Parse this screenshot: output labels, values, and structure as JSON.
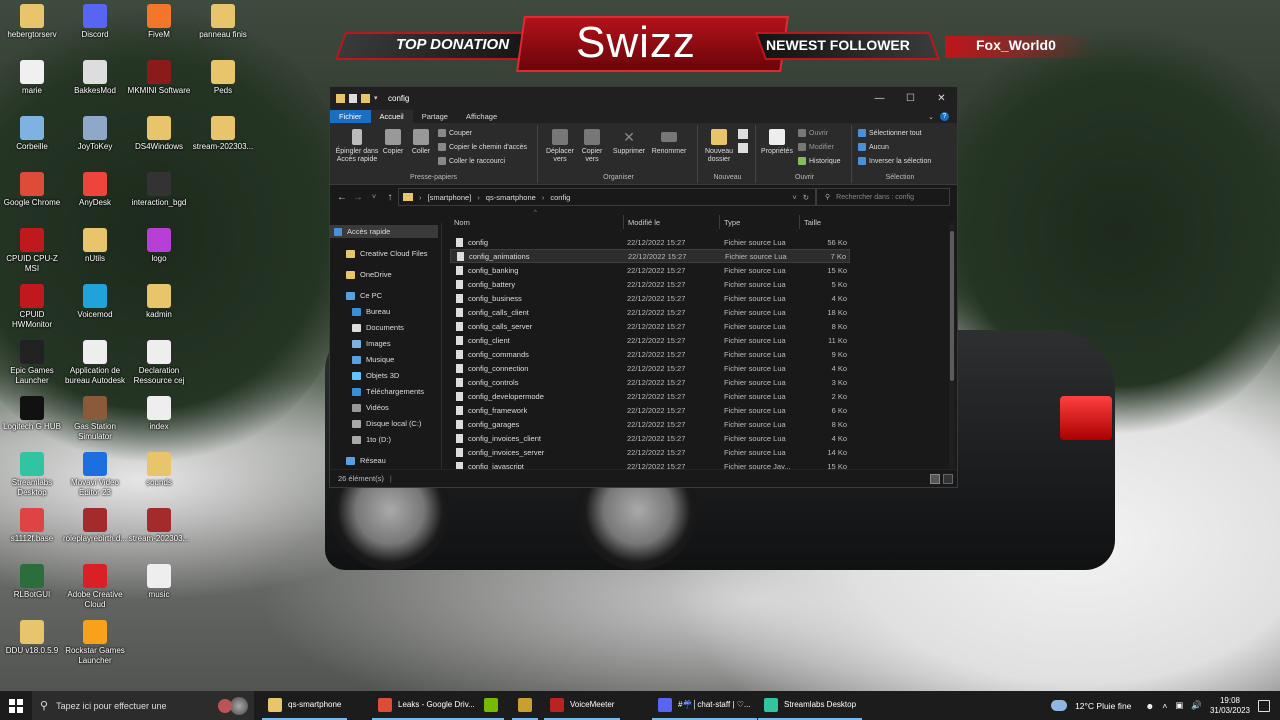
{
  "overlay": {
    "top_donation": "TOP DONATION",
    "streamer": "Swizz",
    "newest_follower_label": "NEWEST FOLLOWER",
    "newest_follower": "Fox_World0"
  },
  "desktop": {
    "col1": [
      {
        "label": "hebergtorserv",
        "icon": "folder-icon",
        "color": "#e8c46b"
      },
      {
        "label": "marie",
        "icon": "document-icon",
        "color": "#f0f0f0"
      },
      {
        "label": "Corbeille",
        "icon": "recycle-bin-icon",
        "color": "#7fb2e0"
      },
      {
        "label": "Google Chrome",
        "icon": "chrome-icon",
        "color": "#dd4b39"
      },
      {
        "label": "CPUID CPU-Z MSI",
        "icon": "cpuz-icon",
        "color": "#c0191d"
      },
      {
        "label": "CPUID HWMonitor",
        "icon": "hwmonitor-icon",
        "color": "#c0191d"
      },
      {
        "label": "Epic Games Launcher",
        "icon": "epic-icon",
        "color": "#222222"
      },
      {
        "label": "Logitech G HUB",
        "icon": "logitech-icon",
        "color": "#111111"
      },
      {
        "label": "Streamlabs Desktop",
        "icon": "streamlabs-icon",
        "color": "#31c3a2"
      },
      {
        "label": "s1112f.base",
        "icon": "database-icon",
        "color": "#d44"
      },
      {
        "label": "RLBotGUI",
        "icon": "rlbot-icon",
        "color": "#2c6e3b"
      },
      {
        "label": "DDU v18.0.5.9",
        "icon": "folder-icon",
        "color": "#e8c46b"
      }
    ],
    "col2": [
      {
        "label": "Discord",
        "icon": "discord-icon",
        "color": "#5865f2"
      },
      {
        "label": "BakkesMod",
        "icon": "bakkesmod-icon",
        "color": "#ddd"
      },
      {
        "label": "JoyToKey",
        "icon": "joystick-icon",
        "color": "#8fa8c8"
      },
      {
        "label": "AnyDesk",
        "icon": "anydesk-icon",
        "color": "#ef443b"
      },
      {
        "label": "nUtils",
        "icon": "folder-icon",
        "color": "#e8c46b"
      },
      {
        "label": "Voicemod",
        "icon": "voicemod-icon",
        "color": "#1fa3d8"
      },
      {
        "label": "Application de bureau Autodesk",
        "icon": "autodesk-icon",
        "color": "#eee"
      },
      {
        "label": "Gas Station Simulator",
        "icon": "game-icon",
        "color": "#8a5a3a"
      },
      {
        "label": "Movavi Video Editor 23",
        "icon": "movavi-icon",
        "color": "#1d6fe0"
      },
      {
        "label": "roleplayrebirth.d...",
        "icon": "archive-icon",
        "color": "#a32b2b"
      },
      {
        "label": "Adobe Creative Cloud",
        "icon": "adobe-cc-icon",
        "color": "#da1f26"
      },
      {
        "label": "Rockstar Games Launcher",
        "icon": "rockstar-icon",
        "color": "#f8a21b"
      }
    ],
    "col3": [
      {
        "label": "FiveM",
        "icon": "fivem-icon",
        "color": "#f2772b"
      },
      {
        "label": "MKMINI Software",
        "icon": "mkmini-icon",
        "color": "#8b1b1b"
      },
      {
        "label": "DS4Windows",
        "icon": "folder-icon",
        "color": "#e8c46b"
      },
      {
        "label": "interaction_bgd",
        "icon": "app-icon",
        "color": "#333"
      },
      {
        "label": "logo",
        "icon": "image-icon",
        "color": "#b83fd6"
      },
      {
        "label": "kadmin",
        "icon": "folder-icon",
        "color": "#e8c46b"
      },
      {
        "label": "Declaration Ressource cej",
        "icon": "document-icon",
        "color": "#eee"
      },
      {
        "label": "index",
        "icon": "html-icon",
        "color": "#eee"
      },
      {
        "label": "sounds",
        "icon": "folder-icon",
        "color": "#e8c46b"
      },
      {
        "label": "stream-202303...",
        "icon": "archive-icon",
        "color": "#a32b2b"
      },
      {
        "label": "music",
        "icon": "music-file-icon",
        "color": "#eee"
      }
    ],
    "col4": [
      {
        "label": "panneau finis",
        "icon": "folder-icon",
        "color": "#e8c46b"
      },
      {
        "label": "Peds",
        "icon": "folder-icon",
        "color": "#e8c46b"
      },
      {
        "label": "stream-202303...",
        "icon": "folder-icon",
        "color": "#e8c46b"
      }
    ]
  },
  "explorer": {
    "title": "config",
    "tabs": [
      "Fichier",
      "Accueil",
      "Partage",
      "Affichage"
    ],
    "ribbon": {
      "pin": "Épingler dans Accès rapide",
      "copy": "Copier",
      "paste": "Coller",
      "cut": "Couper",
      "copy_path": "Copier le chemin d'accès",
      "paste_shortcut": "Coller le raccourci",
      "clipboard_group": "Presse-papiers",
      "move_to": "Déplacer vers",
      "copy_to": "Copier vers",
      "delete": "Supprimer",
      "rename": "Renommer",
      "organize_group": "Organiser",
      "new_folder": "Nouveau dossier",
      "new_group": "Nouveau",
      "properties": "Propriétés",
      "open": "Ouvrir",
      "modify": "Modifier",
      "history": "Historique",
      "open_group": "Ouvrir",
      "select_all": "Sélectionner tout",
      "select_none": "Aucun",
      "invert_selection": "Inverser la sélection",
      "select_group": "Sélection"
    },
    "path": [
      "[smartphone]",
      "qs-smartphone",
      "config"
    ],
    "search_placeholder": "Rechercher dans : config",
    "nav": {
      "quick_access": "Accès rapide",
      "creative_cloud": "Creative Cloud Files",
      "onedrive": "OneDrive",
      "this_pc": "Ce PC",
      "desktop": "Bureau",
      "documents": "Documents",
      "images": "Images",
      "music": "Musique",
      "objects3d": "Objets 3D",
      "downloads": "Téléchargements",
      "videos": "Vidéos",
      "local_disk": "Disque local (C:)",
      "drive_d": "1to (D:)",
      "network": "Réseau"
    },
    "columns": {
      "name": "Nom",
      "modified": "Modifié le",
      "type": "Type",
      "size": "Taille"
    },
    "files": [
      {
        "name": "config",
        "date": "22/12/2022 15:27",
        "type": "Fichier source Lua",
        "size": "56 Ko"
      },
      {
        "name": "config_animations",
        "date": "22/12/2022 15:27",
        "type": "Fichier source Lua",
        "size": "7 Ko"
      },
      {
        "name": "config_banking",
        "date": "22/12/2022 15:27",
        "type": "Fichier source Lua",
        "size": "15 Ko"
      },
      {
        "name": "config_battery",
        "date": "22/12/2022 15:27",
        "type": "Fichier source Lua",
        "size": "5 Ko"
      },
      {
        "name": "config_business",
        "date": "22/12/2022 15:27",
        "type": "Fichier source Lua",
        "size": "4 Ko"
      },
      {
        "name": "config_calls_client",
        "date": "22/12/2022 15:27",
        "type": "Fichier source Lua",
        "size": "18 Ko"
      },
      {
        "name": "config_calls_server",
        "date": "22/12/2022 15:27",
        "type": "Fichier source Lua",
        "size": "8 Ko"
      },
      {
        "name": "config_client",
        "date": "22/12/2022 15:27",
        "type": "Fichier source Lua",
        "size": "11 Ko"
      },
      {
        "name": "config_commands",
        "date": "22/12/2022 15:27",
        "type": "Fichier source Lua",
        "size": "9 Ko"
      },
      {
        "name": "config_connection",
        "date": "22/12/2022 15:27",
        "type": "Fichier source Lua",
        "size": "4 Ko"
      },
      {
        "name": "config_controls",
        "date": "22/12/2022 15:27",
        "type": "Fichier source Lua",
        "size": "3 Ko"
      },
      {
        "name": "config_developermode",
        "date": "22/12/2022 15:27",
        "type": "Fichier source Lua",
        "size": "2 Ko"
      },
      {
        "name": "config_framework",
        "date": "22/12/2022 15:27",
        "type": "Fichier source Lua",
        "size": "6 Ko"
      },
      {
        "name": "config_garages",
        "date": "22/12/2022 15:27",
        "type": "Fichier source Lua",
        "size": "8 Ko"
      },
      {
        "name": "config_invoices_client",
        "date": "22/12/2022 15:27",
        "type": "Fichier source Lua",
        "size": "4 Ko"
      },
      {
        "name": "config_invoices_server",
        "date": "22/12/2022 15:27",
        "type": "Fichier source Lua",
        "size": "14 Ko"
      },
      {
        "name": "config_javascript",
        "date": "22/12/2022 15:27",
        "type": "Fichier source Jav...",
        "size": "15 Ko"
      }
    ],
    "status": "26 élément(s)"
  },
  "taskbar": {
    "search_placeholder": "Tapez ici pour effectuer une",
    "items": [
      {
        "label": "qs-smartphone",
        "icon": "folder-icon",
        "color": "#e8c46b"
      },
      {
        "label": "Leaks - Google Driv...",
        "icon": "chrome-icon",
        "color": "#dd4b39"
      },
      {
        "label": "",
        "icon": "nvidia-icon",
        "color": "#76b900"
      },
      {
        "label": "",
        "icon": "app-icon",
        "color": "#c8a030"
      },
      {
        "label": "VoiceMeeter",
        "icon": "voicemeeter-icon",
        "color": "#b22"
      },
      {
        "label": "#☔│chat-staff | ♡...",
        "icon": "discord-icon",
        "color": "#5865f2"
      },
      {
        "label": "Streamlabs Desktop",
        "icon": "streamlabs-icon",
        "color": "#31c3a2"
      }
    ],
    "weather": "12°C Pluie fine",
    "time": "19:08",
    "date": "31/03/2023"
  }
}
